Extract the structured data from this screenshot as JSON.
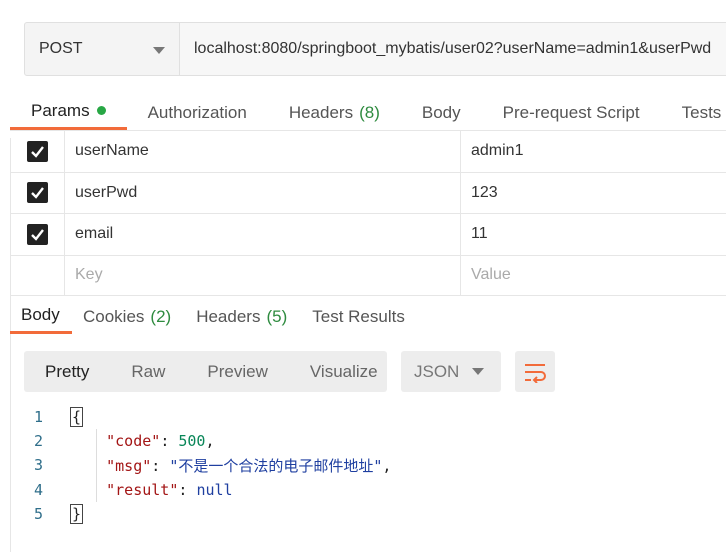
{
  "request": {
    "method": "POST",
    "url": "localhost:8080/springboot_mybatis/user02?userName=admin1&userPwd"
  },
  "request_tabs": [
    {
      "label": "Params",
      "count": "",
      "active": true
    },
    {
      "label": "Authorization",
      "count": ""
    },
    {
      "label": "Headers",
      "count": "(8)"
    },
    {
      "label": "Body",
      "count": ""
    },
    {
      "label": "Pre-request Script",
      "count": ""
    },
    {
      "label": "Tests",
      "count": ""
    }
  ],
  "params": [
    {
      "key": "userName",
      "value": "admin1",
      "checked": true
    },
    {
      "key": "userPwd",
      "value": "123",
      "checked": true
    },
    {
      "key": "email",
      "value": "11",
      "checked": true
    }
  ],
  "params_placeholder": {
    "key": "Key",
    "value": "Value"
  },
  "response_tabs": [
    {
      "label": "Body",
      "count": "",
      "active": true
    },
    {
      "label": "Cookies",
      "count": "(2)"
    },
    {
      "label": "Headers",
      "count": "(5)"
    },
    {
      "label": "Test Results",
      "count": ""
    }
  ],
  "view_modes": [
    "Pretty",
    "Raw",
    "Preview",
    "Visualize"
  ],
  "format": "JSON",
  "response_body": {
    "line_numbers": [
      "1",
      "2",
      "3",
      "4",
      "5"
    ],
    "open_brace": "{",
    "close_brace": "}",
    "code_key": "\"code\"",
    "code_value": "500",
    "msg_key": "\"msg\"",
    "msg_value": "\"不是一个合法的电子邮件地址\"",
    "result_key": "\"result\"",
    "result_value": "null"
  },
  "colors": {
    "accent": "#f26b3a",
    "count_green": "#2e8b3f",
    "dot_green": "#28a745"
  }
}
